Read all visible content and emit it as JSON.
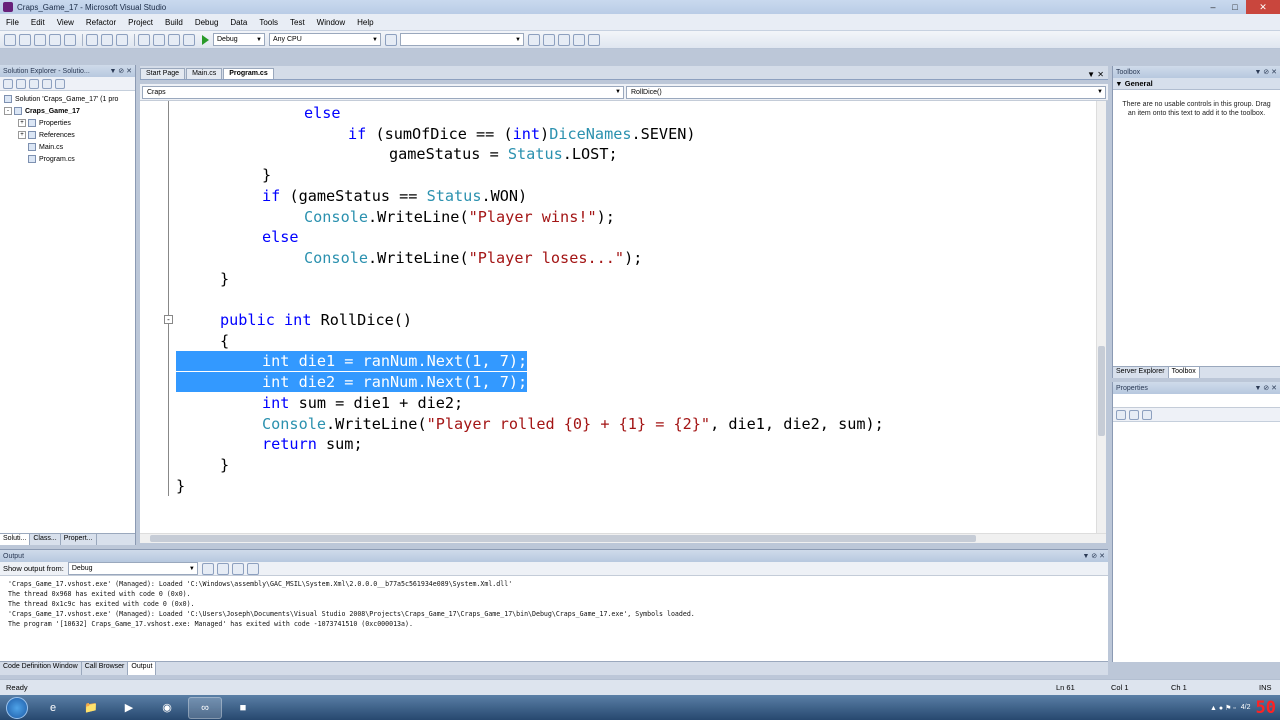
{
  "window": {
    "title": "Craps_Game_17 - Microsoft Visual Studio"
  },
  "menu": [
    "File",
    "Edit",
    "View",
    "Refactor",
    "Project",
    "Build",
    "Debug",
    "Data",
    "Tools",
    "Test",
    "Window",
    "Help"
  ],
  "toolbar": {
    "config": "Debug",
    "platform": "Any CPU"
  },
  "solution_explorer": {
    "title": "Solution Explorer - Solutio...",
    "tree": [
      "Solution 'Craps_Game_17' (1 pro",
      "Craps_Game_17",
      "Properties",
      "References",
      "Main.cs",
      "Program.cs"
    ],
    "tabs": [
      "Soluti...",
      "Class...",
      "Propert..."
    ]
  },
  "editor": {
    "tabs": [
      "Start Page",
      "Main.cs",
      "Program.cs"
    ],
    "class_combo": "Craps",
    "member_combo": "RollDice()",
    "lines": [
      [
        [
          "else",
          "kw"
        ]
      ],
      [
        [
          "if",
          "kw"
        ],
        [
          " (sumOfDice == (",
          ""
        ],
        [
          "int",
          "kw"
        ],
        [
          ")",
          ""
        ],
        [
          "DiceNames",
          "ty"
        ],
        [
          ".SEVEN)",
          ""
        ]
      ],
      [
        [
          "gameStatus = ",
          ""
        ],
        [
          "Status",
          "ty"
        ],
        [
          ".LOST;",
          ""
        ]
      ],
      [
        [
          "}",
          ""
        ]
      ],
      [
        [
          "if",
          "kw"
        ],
        [
          " (gameStatus == ",
          ""
        ],
        [
          "Status",
          "ty"
        ],
        [
          ".WON)",
          ""
        ]
      ],
      [
        [
          "Console",
          "ty"
        ],
        [
          ".WriteLine(",
          ""
        ],
        [
          "\"Player wins!\"",
          "str"
        ],
        [
          ");",
          ""
        ]
      ],
      [
        [
          "else",
          "kw"
        ]
      ],
      [
        [
          "Console",
          "ty"
        ],
        [
          ".WriteLine(",
          ""
        ],
        [
          "\"Player loses...\"",
          "str"
        ],
        [
          ");",
          ""
        ]
      ],
      [
        [
          "}",
          ""
        ]
      ],
      [
        [
          "",
          ""
        ]
      ],
      [
        [
          "public",
          "kw"
        ],
        [
          " ",
          ""
        ],
        [
          "int",
          "kw"
        ],
        [
          " RollDice()",
          ""
        ]
      ],
      [
        [
          "{",
          ""
        ]
      ],
      [
        [
          "int die1 = ranNum.Next(1, 7);",
          "sel"
        ]
      ],
      [
        [
          "int die2 = ranNum.Next(1, 7);",
          "sel"
        ]
      ],
      [
        [
          "int",
          "kw"
        ],
        [
          " sum = die1 + die2;",
          ""
        ]
      ],
      [
        [
          "Console",
          "ty"
        ],
        [
          ".WriteLine(",
          ""
        ],
        [
          "\"Player rolled {0} + {1} = {2}\"",
          "str"
        ],
        [
          ", die1, die2, sum);",
          ""
        ]
      ],
      [
        [
          "return",
          "kw"
        ],
        [
          " sum;",
          ""
        ]
      ],
      [
        [
          "}",
          ""
        ]
      ],
      [
        [
          "}",
          ""
        ]
      ]
    ]
  },
  "toolbox": {
    "title": "Toolbox",
    "group": "General",
    "message": "There are no usable controls in this group. Drag an item onto this text to add it to the toolbox.",
    "tabs": [
      "Server Explorer",
      "Toolbox"
    ]
  },
  "properties": {
    "title": "Properties"
  },
  "output": {
    "title": "Output",
    "show_from_label": "Show output from:",
    "show_from_value": "Debug",
    "lines": [
      "'Craps_Game_17.vshost.exe' (Managed): Loaded 'C:\\Windows\\assembly\\GAC_MSIL\\System.Xml\\2.0.0.0__b77a5c561934e089\\System.Xml.dll'",
      "The thread 0x968 has exited with code 0 (0x0).",
      "The thread 0x1c9c has exited with code 0 (0x0).",
      "'Craps_Game_17.vshost.exe' (Managed): Loaded 'C:\\Users\\Joseph\\Documents\\Visual Studio 2008\\Projects\\Craps_Game_17\\Craps_Game_17\\bin\\Debug\\Craps_Game_17.exe', Symbols loaded.",
      "The program '[10632] Craps_Game_17.vshost.exe: Managed' has exited with code -1073741510 (0xc000013a)."
    ],
    "tabs": [
      "Code Definition Window",
      "Call Browser",
      "Output"
    ]
  },
  "status": {
    "ready": "Ready",
    "ln": "Ln 61",
    "col": "Col 1",
    "ch": "Ch 1",
    "ins": "INS"
  },
  "taskbar": {
    "date": "4/2",
    "rec": "50"
  }
}
